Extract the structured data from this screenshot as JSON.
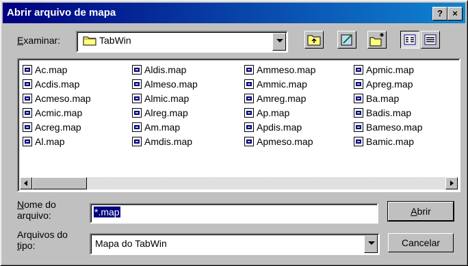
{
  "window": {
    "title": "Abrir arquivo de mapa",
    "help_label": "?",
    "close_label": "×"
  },
  "toolbar": {
    "look_in_label": "Examinar:",
    "look_in_value": "TabWin",
    "buttons": [
      "up-folder-icon",
      "new-shortcut-icon",
      "new-folder-icon",
      "list-view-icon",
      "details-view-icon"
    ]
  },
  "files": [
    [
      "Ac.map",
      "Acdis.map",
      "Acmeso.map",
      "Acmic.map",
      "Acreg.map",
      "Al.map"
    ],
    [
      "Aldis.map",
      "Almeso.map",
      "Almic.map",
      "Alreg.map",
      "Am.map",
      "Amdis.map"
    ],
    [
      "Ammeso.map",
      "Ammic.map",
      "Amreg.map",
      "Ap.map",
      "Apdis.map",
      "Apmeso.map"
    ],
    [
      "Apmic.map",
      "Apreg.map",
      "Ba.map",
      "Badis.map",
      "Bameso.map",
      "Bamic.map"
    ]
  ],
  "filename": {
    "label_line1": "Nome do",
    "label_line2": "arquivo:",
    "value": "*.map"
  },
  "filetype": {
    "label_line1": "Arquivos do",
    "label_line2": "tipo:",
    "value": "Mapa do TabWin"
  },
  "buttons": {
    "open": "Abrir",
    "cancel": "Cancelar"
  }
}
